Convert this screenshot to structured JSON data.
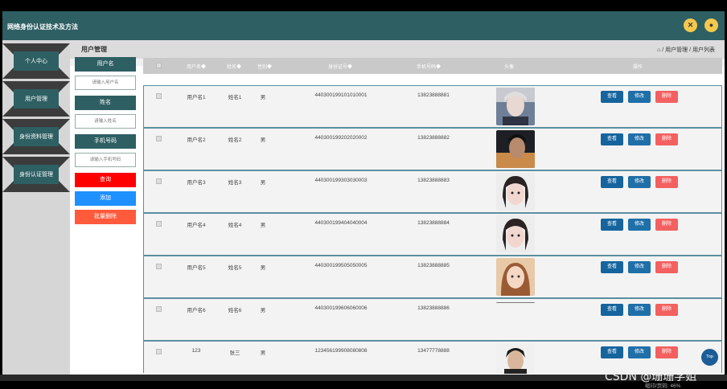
{
  "app": {
    "title": "网络身份认证技术及方法"
  },
  "topbar": {
    "icon1": "crosshair-icon",
    "icon2": "user-icon"
  },
  "sidebar": {
    "items": [
      {
        "label": "个人中心"
      },
      {
        "label": "用户管理"
      },
      {
        "label": "身份资料管理"
      },
      {
        "label": "身份认证管理"
      }
    ]
  },
  "header": {
    "page_title": "用户管理",
    "breadcrumb": "⌂ / 用户管理 / 用户列表"
  },
  "search": {
    "username_label": "用户名",
    "username_placeholder": "请输入用户名",
    "name_label": "姓名",
    "name_placeholder": "请输入姓名",
    "phone_label": "手机号码",
    "phone_placeholder": "请输入手机号码",
    "query_label": "查询",
    "add_label": "添加",
    "batch_delete_label": "批量删除"
  },
  "table": {
    "columns": [
      "用户名◆",
      "姓名◆",
      "性别◆",
      "身份证号◆",
      "手机号码◆",
      "头像",
      "操作"
    ],
    "rows": [
      {
        "username": "用户名1",
        "name": "姓名1",
        "gender": "男",
        "id_number": "440300199101010001",
        "phone": "13823888881"
      },
      {
        "username": "用户名2",
        "name": "姓名2",
        "gender": "男",
        "id_number": "440300199202020002",
        "phone": "13823888882"
      },
      {
        "username": "用户名3",
        "name": "姓名3",
        "gender": "男",
        "id_number": "440300199303030003",
        "phone": "13823888883"
      },
      {
        "username": "用户名4",
        "name": "姓名4",
        "gender": "男",
        "id_number": "440300199404040004",
        "phone": "13823888884"
      },
      {
        "username": "用户名5",
        "name": "姓名5",
        "gender": "男",
        "id_number": "440300199505050005",
        "phone": "13823888885"
      },
      {
        "username": "用户名6",
        "name": "姓名6",
        "gender": "男",
        "id_number": "440300199606060006",
        "phone": "13823888886"
      },
      {
        "username": "123",
        "name": "张三",
        "gender": "男",
        "id_number": "123456199908080808",
        "phone": "13477778888"
      }
    ],
    "actions": {
      "view": "查看",
      "edit": "修改",
      "delete": "删除"
    }
  },
  "top_button": "Top",
  "watermark": "CSDN @珊珊学姐",
  "zoom_text": "缩印/页码: 46%",
  "colors": {
    "topbar": "#2e5f63",
    "query": "#ff0000",
    "add": "#1e90ff",
    "batch_delete": "#ff5a3c",
    "view": "#15649d",
    "edit": "#1f6fa8",
    "delete": "#f36060"
  }
}
